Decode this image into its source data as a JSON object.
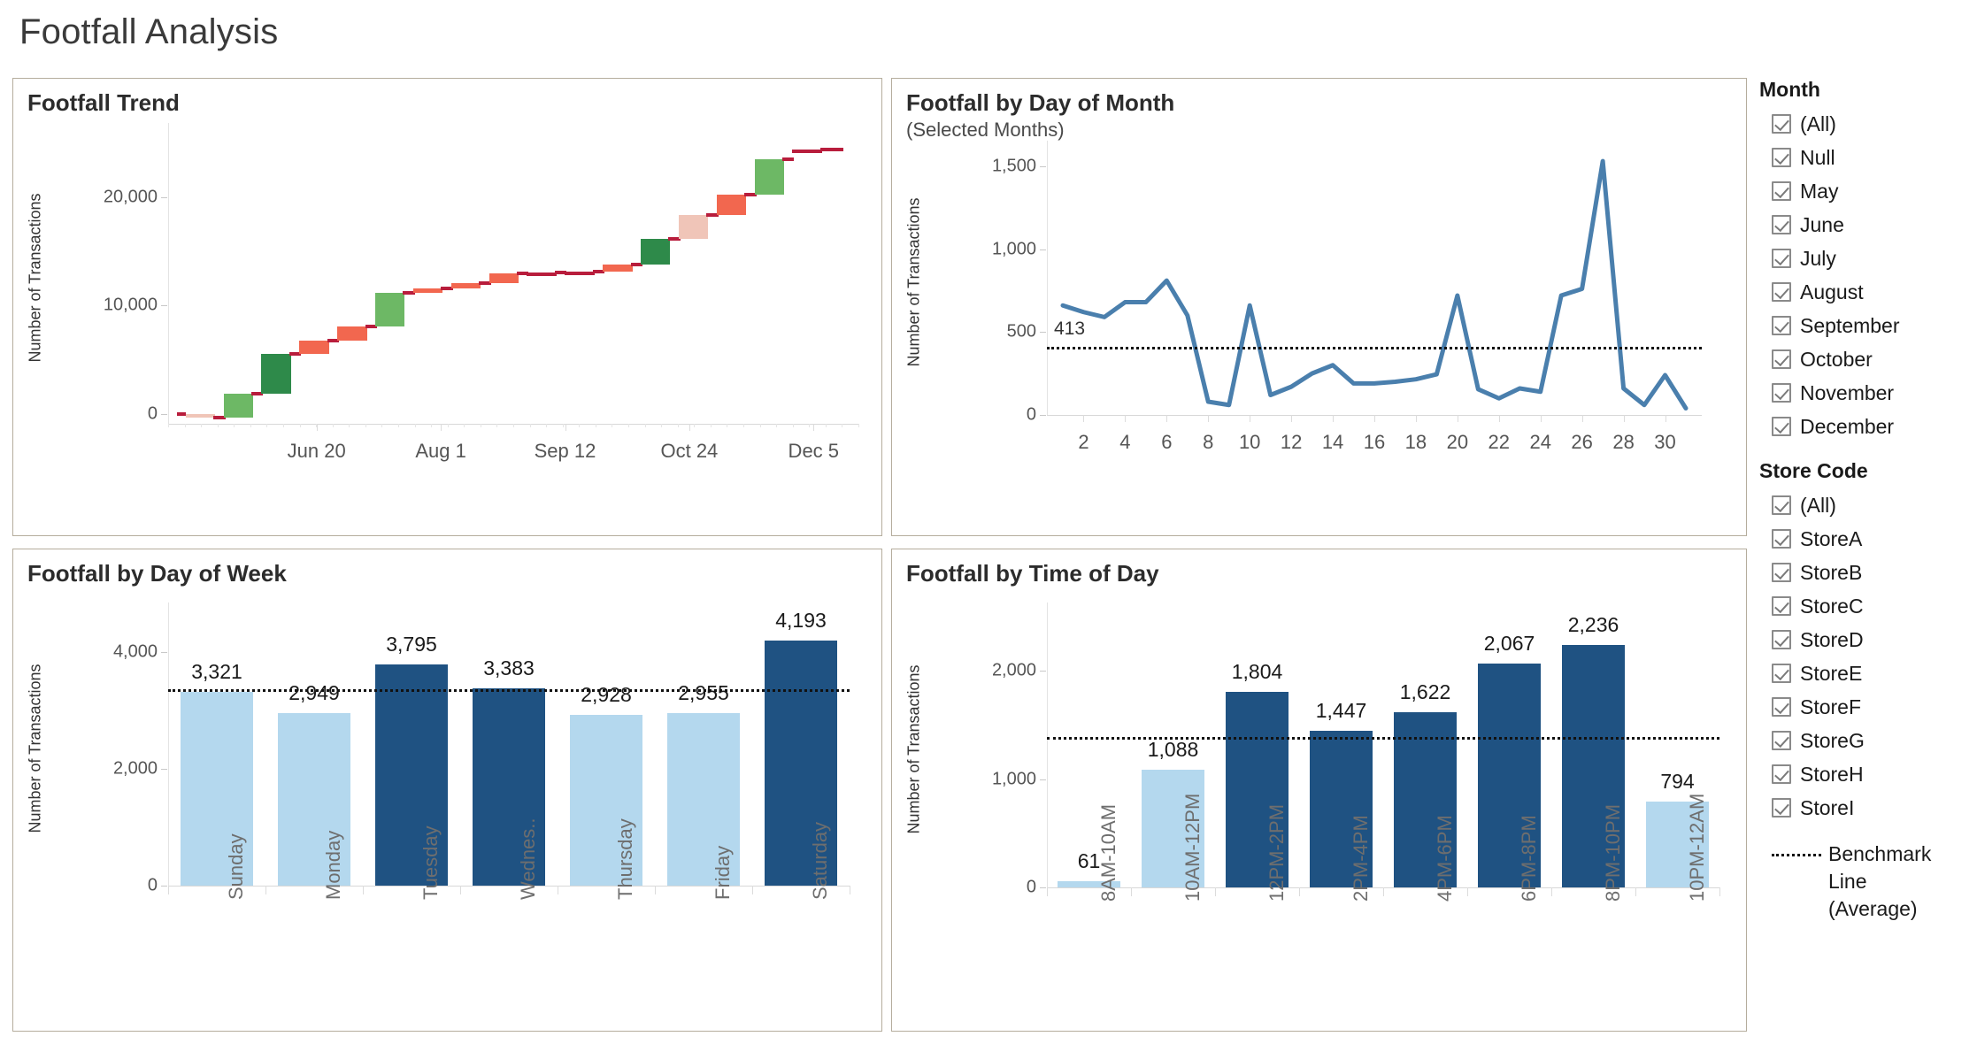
{
  "page": {
    "title": "Footfall Analysis"
  },
  "panels": {
    "trend": {
      "title": "Footfall Trend"
    },
    "dom": {
      "title": "Footfall by Day of Month",
      "subtitle": "(Selected Months)"
    },
    "dow": {
      "title": "Footfall by Day of Week"
    },
    "tod": {
      "title": "Footfall by Time of Day"
    }
  },
  "filters": {
    "month": {
      "title": "Month",
      "items": [
        {
          "label": "(All)",
          "checked": true
        },
        {
          "label": "Null",
          "checked": true
        },
        {
          "label": "May",
          "checked": true
        },
        {
          "label": "June",
          "checked": true
        },
        {
          "label": "July",
          "checked": true
        },
        {
          "label": "August",
          "checked": true
        },
        {
          "label": "September",
          "checked": true
        },
        {
          "label": "October",
          "checked": true
        },
        {
          "label": "November",
          "checked": true
        },
        {
          "label": "December",
          "checked": true
        }
      ]
    },
    "store": {
      "title": "Store Code",
      "items": [
        {
          "label": "(All)",
          "checked": true
        },
        {
          "label": "StoreA",
          "checked": true
        },
        {
          "label": "StoreB",
          "checked": true
        },
        {
          "label": "StoreC",
          "checked": true
        },
        {
          "label": "StoreD",
          "checked": true
        },
        {
          "label": "StoreE",
          "checked": true
        },
        {
          "label": "StoreF",
          "checked": true
        },
        {
          "label": "StoreG",
          "checked": true
        },
        {
          "label": "StoreH",
          "checked": true
        },
        {
          "label": "StoreI",
          "checked": true
        }
      ]
    },
    "legend": {
      "line1": "Benchmark Line",
      "line2": "(Average)"
    }
  },
  "colors": {
    "panel_border": "#b5ad9d",
    "bar_dark": "#1f5282",
    "bar_light": "#b4d8ee",
    "line_blue": "#4a7fad",
    "wf_green": "#6db865",
    "wf_green_dark": "#2e8a4a",
    "wf_red": "#f2674f",
    "wf_red_pale": "#f0c5b8",
    "wf_connector": "#b81d3c",
    "benchmark": "#111111"
  },
  "chart_data": [
    {
      "id": "trend",
      "type": "waterfall",
      "title": "Footfall Trend",
      "xlabel": "",
      "ylabel": "Number of Transactions",
      "ylim": [
        -900,
        26000
      ],
      "yticks": [
        0,
        10000,
        20000
      ],
      "ytick_labels": [
        "0",
        "10,000",
        "20,000"
      ],
      "xtick_labels": [
        "Jun 20",
        "Aug 1",
        "Sep 12",
        "Oct 24",
        "Dec 5"
      ],
      "xtick_positions": [
        0.215,
        0.395,
        0.575,
        0.755,
        0.935
      ],
      "grid": false,
      "note": "Cumulative running-total waterfall; each step is a period delta.",
      "steps": [
        {
          "start": 0,
          "end": -350,
          "dir": "down",
          "shade": "pale"
        },
        {
          "start": -350,
          "end": 1900,
          "dir": "up",
          "shade": "light"
        },
        {
          "start": 1900,
          "end": 5500,
          "dir": "up",
          "shade": "dark"
        },
        {
          "start": 5500,
          "end": 6800,
          "dir": "down",
          "shade": "normal"
        },
        {
          "start": 6800,
          "end": 8100,
          "dir": "down",
          "shade": "normal"
        },
        {
          "start": 8100,
          "end": 11200,
          "dir": "up",
          "shade": "light"
        },
        {
          "start": 11200,
          "end": 11600,
          "dir": "down",
          "shade": "normal"
        },
        {
          "start": 11600,
          "end": 12100,
          "dir": "down",
          "shade": "normal"
        },
        {
          "start": 12100,
          "end": 12950,
          "dir": "down",
          "shade": "normal"
        },
        {
          "start": 12950,
          "end": 13050,
          "dir": "flat",
          "shade": "normal"
        },
        {
          "start": 13050,
          "end": 13100,
          "dir": "flat",
          "shade": "normal"
        },
        {
          "start": 13100,
          "end": 13750,
          "dir": "down",
          "shade": "normal"
        },
        {
          "start": 13750,
          "end": 16100,
          "dir": "up",
          "shade": "verydark"
        },
        {
          "start": 16100,
          "end": 18300,
          "dir": "down",
          "shade": "pale"
        },
        {
          "start": 18300,
          "end": 20200,
          "dir": "down",
          "shade": "normal"
        },
        {
          "start": 20200,
          "end": 23500,
          "dir": "up",
          "shade": "light"
        },
        {
          "start": 23500,
          "end": 24400,
          "dir": "flat",
          "shade": "normal"
        }
      ]
    },
    {
      "id": "day_of_month",
      "type": "line",
      "title": "Footfall by Day of Month",
      "subtitle": "(Selected Months)",
      "xlabel": "",
      "ylabel": "Number of Transactions",
      "ylim": [
        0,
        1600
      ],
      "yticks": [
        0,
        500,
        1000,
        1500
      ],
      "ytick_labels": [
        "0",
        "500",
        "1,000",
        "1,500"
      ],
      "x": [
        1,
        2,
        3,
        4,
        5,
        6,
        7,
        8,
        9,
        10,
        11,
        12,
        13,
        14,
        15,
        16,
        17,
        18,
        19,
        20,
        21,
        22,
        23,
        24,
        25,
        26,
        27,
        28,
        29,
        30,
        31
      ],
      "xtick_labels": [
        "2",
        "4",
        "6",
        "8",
        "10",
        "12",
        "14",
        "16",
        "18",
        "20",
        "22",
        "24",
        "26",
        "28",
        "30"
      ],
      "values": [
        660,
        620,
        590,
        680,
        680,
        810,
        600,
        80,
        60,
        660,
        120,
        170,
        250,
        300,
        190,
        190,
        200,
        215,
        245,
        720,
        155,
        100,
        160,
        140,
        720,
        760,
        1530,
        160,
        60,
        240,
        40
      ],
      "benchmark": {
        "value": 413,
        "label": "413",
        "style": "dotted",
        "name": "Benchmark Line (Average)"
      },
      "grid": false
    },
    {
      "id": "day_of_week",
      "type": "bar",
      "title": "Footfall by Day of Week",
      "xlabel": "",
      "ylabel": "Number of Transactions",
      "ylim": [
        0,
        4700
      ],
      "yticks": [
        0,
        2000,
        4000
      ],
      "ytick_labels": [
        "0",
        "2,000",
        "4,000"
      ],
      "categories": [
        "Sunday",
        "Monday",
        "Tuesday",
        "Wednes..",
        "Thursday",
        "Friday",
        "Saturday"
      ],
      "values": [
        3321,
        2949,
        3795,
        3383,
        2928,
        2955,
        4193
      ],
      "value_labels": [
        "3,321",
        "2,949",
        "3,795",
        "3,383",
        "2,928",
        "2,955",
        "4,193"
      ],
      "above_benchmark": [
        false,
        false,
        true,
        true,
        false,
        false,
        true
      ],
      "benchmark": {
        "value": 3360,
        "name": "Benchmark Line (Average)"
      },
      "grid": false
    },
    {
      "id": "time_of_day",
      "type": "bar",
      "title": "Footfall by Time of Day",
      "xlabel": "",
      "ylabel": "Number of Transactions",
      "ylim": [
        0,
        2550
      ],
      "yticks": [
        0,
        1000,
        2000
      ],
      "ytick_labels": [
        "0",
        "1,000",
        "2,000"
      ],
      "categories": [
        "8AM-10AM",
        "10AM-12PM",
        "12PM-2PM",
        "2PM-4PM",
        "4PM-6PM",
        "6PM-8PM",
        "8PM-10PM",
        "10PM-12AM"
      ],
      "values": [
        61,
        1088,
        1804,
        1447,
        1622,
        2067,
        2236,
        794
      ],
      "value_labels": [
        "61",
        "1,088",
        "1,804",
        "1,447",
        "1,622",
        "2,067",
        "2,236",
        "794"
      ],
      "above_benchmark": [
        false,
        false,
        true,
        true,
        true,
        true,
        true,
        false
      ],
      "benchmark": {
        "value": 1390,
        "name": "Benchmark Line (Average)"
      },
      "grid": false
    }
  ]
}
